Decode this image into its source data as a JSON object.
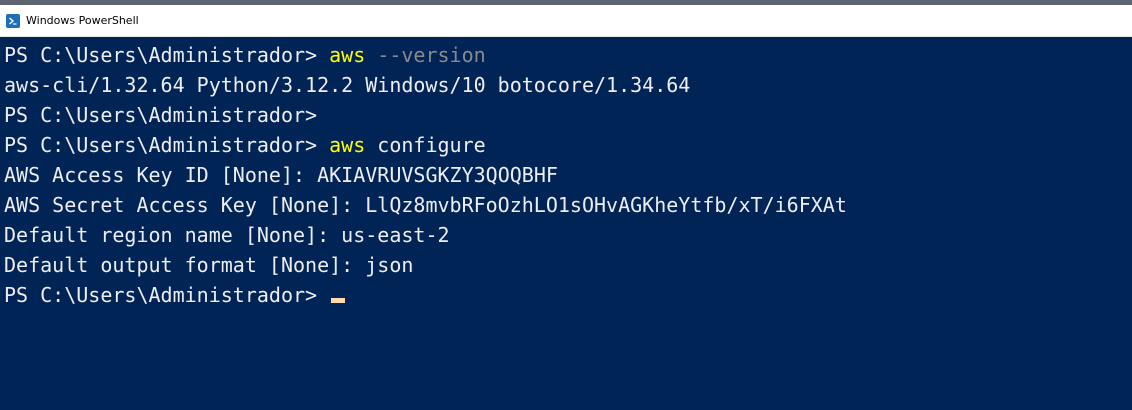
{
  "window": {
    "title": "Windows PowerShell",
    "icon": "powershell-icon"
  },
  "console": {
    "colors": {
      "background": "#012456",
      "text": "#eeedf0",
      "command": "#ffff00",
      "parameter": "#8a8a8a",
      "cursor": "#fedba9"
    },
    "lines": [
      {
        "prompt": "PS C:\\Users\\Administrador> ",
        "command": "aws",
        "args": " --version"
      },
      {
        "text": "aws-cli/1.32.64 Python/3.12.2 Windows/10 botocore/1.34.64"
      },
      {
        "prompt": "PS C:\\Users\\Administrador>"
      },
      {
        "prompt": "PS C:\\Users\\Administrador> ",
        "command": "aws",
        "args": " configure"
      },
      {
        "label": "AWS Access Key ID [None]: ",
        "value": "AKIAVRUVSGKZY3QOQBHF"
      },
      {
        "label": "AWS Secret Access Key [None]: ",
        "value": "LlQz8mvbRFoOzhLO1sOHvAGKheYtfb/xT/i6FXAt"
      },
      {
        "label": "Default region name [None]: ",
        "value": "us-east-2"
      },
      {
        "label": "Default output format [None]: ",
        "value": "json"
      },
      {
        "prompt": "PS C:\\Users\\Administrador> "
      }
    ]
  }
}
